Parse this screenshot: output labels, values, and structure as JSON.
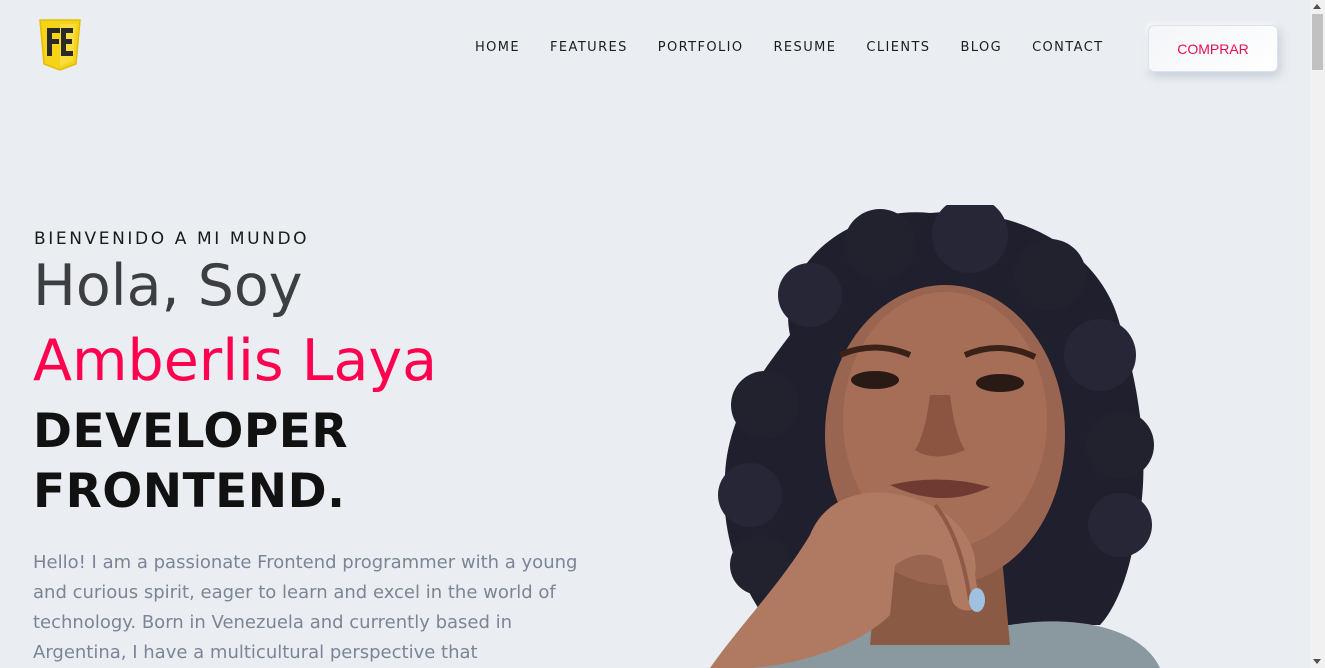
{
  "header": {
    "logo_alt": "logo",
    "nav": [
      {
        "label": "HOME"
      },
      {
        "label": "FEATURES"
      },
      {
        "label": "PORTFOLIO"
      },
      {
        "label": "RESUME"
      },
      {
        "label": "CLIENTS"
      },
      {
        "label": "BLOG"
      },
      {
        "label": "CONTACT"
      }
    ],
    "buy_label": "COMPRAR"
  },
  "hero": {
    "welcome": "BIENVENIDO A MI MUNDO",
    "greeting": "Hola, Soy",
    "name": "Amberlis Laya",
    "role_line1": "DEVELOPER",
    "role_line2": "FRONTEND.",
    "intro": "Hello! I am a passionate Frontend programmer with a young and curious spirit, eager to learn and excel in the world of technology. Born in Venezuela and currently based in Argentina, I have a multicultural perspective that"
  },
  "colors": {
    "background": "#eaeef2",
    "accent": "#ff014f",
    "heading": "#3c3e41",
    "body_text": "#7b8595",
    "logo_yellow": "#f5d418"
  },
  "icons": {
    "logo": "fe-shield-logo"
  }
}
